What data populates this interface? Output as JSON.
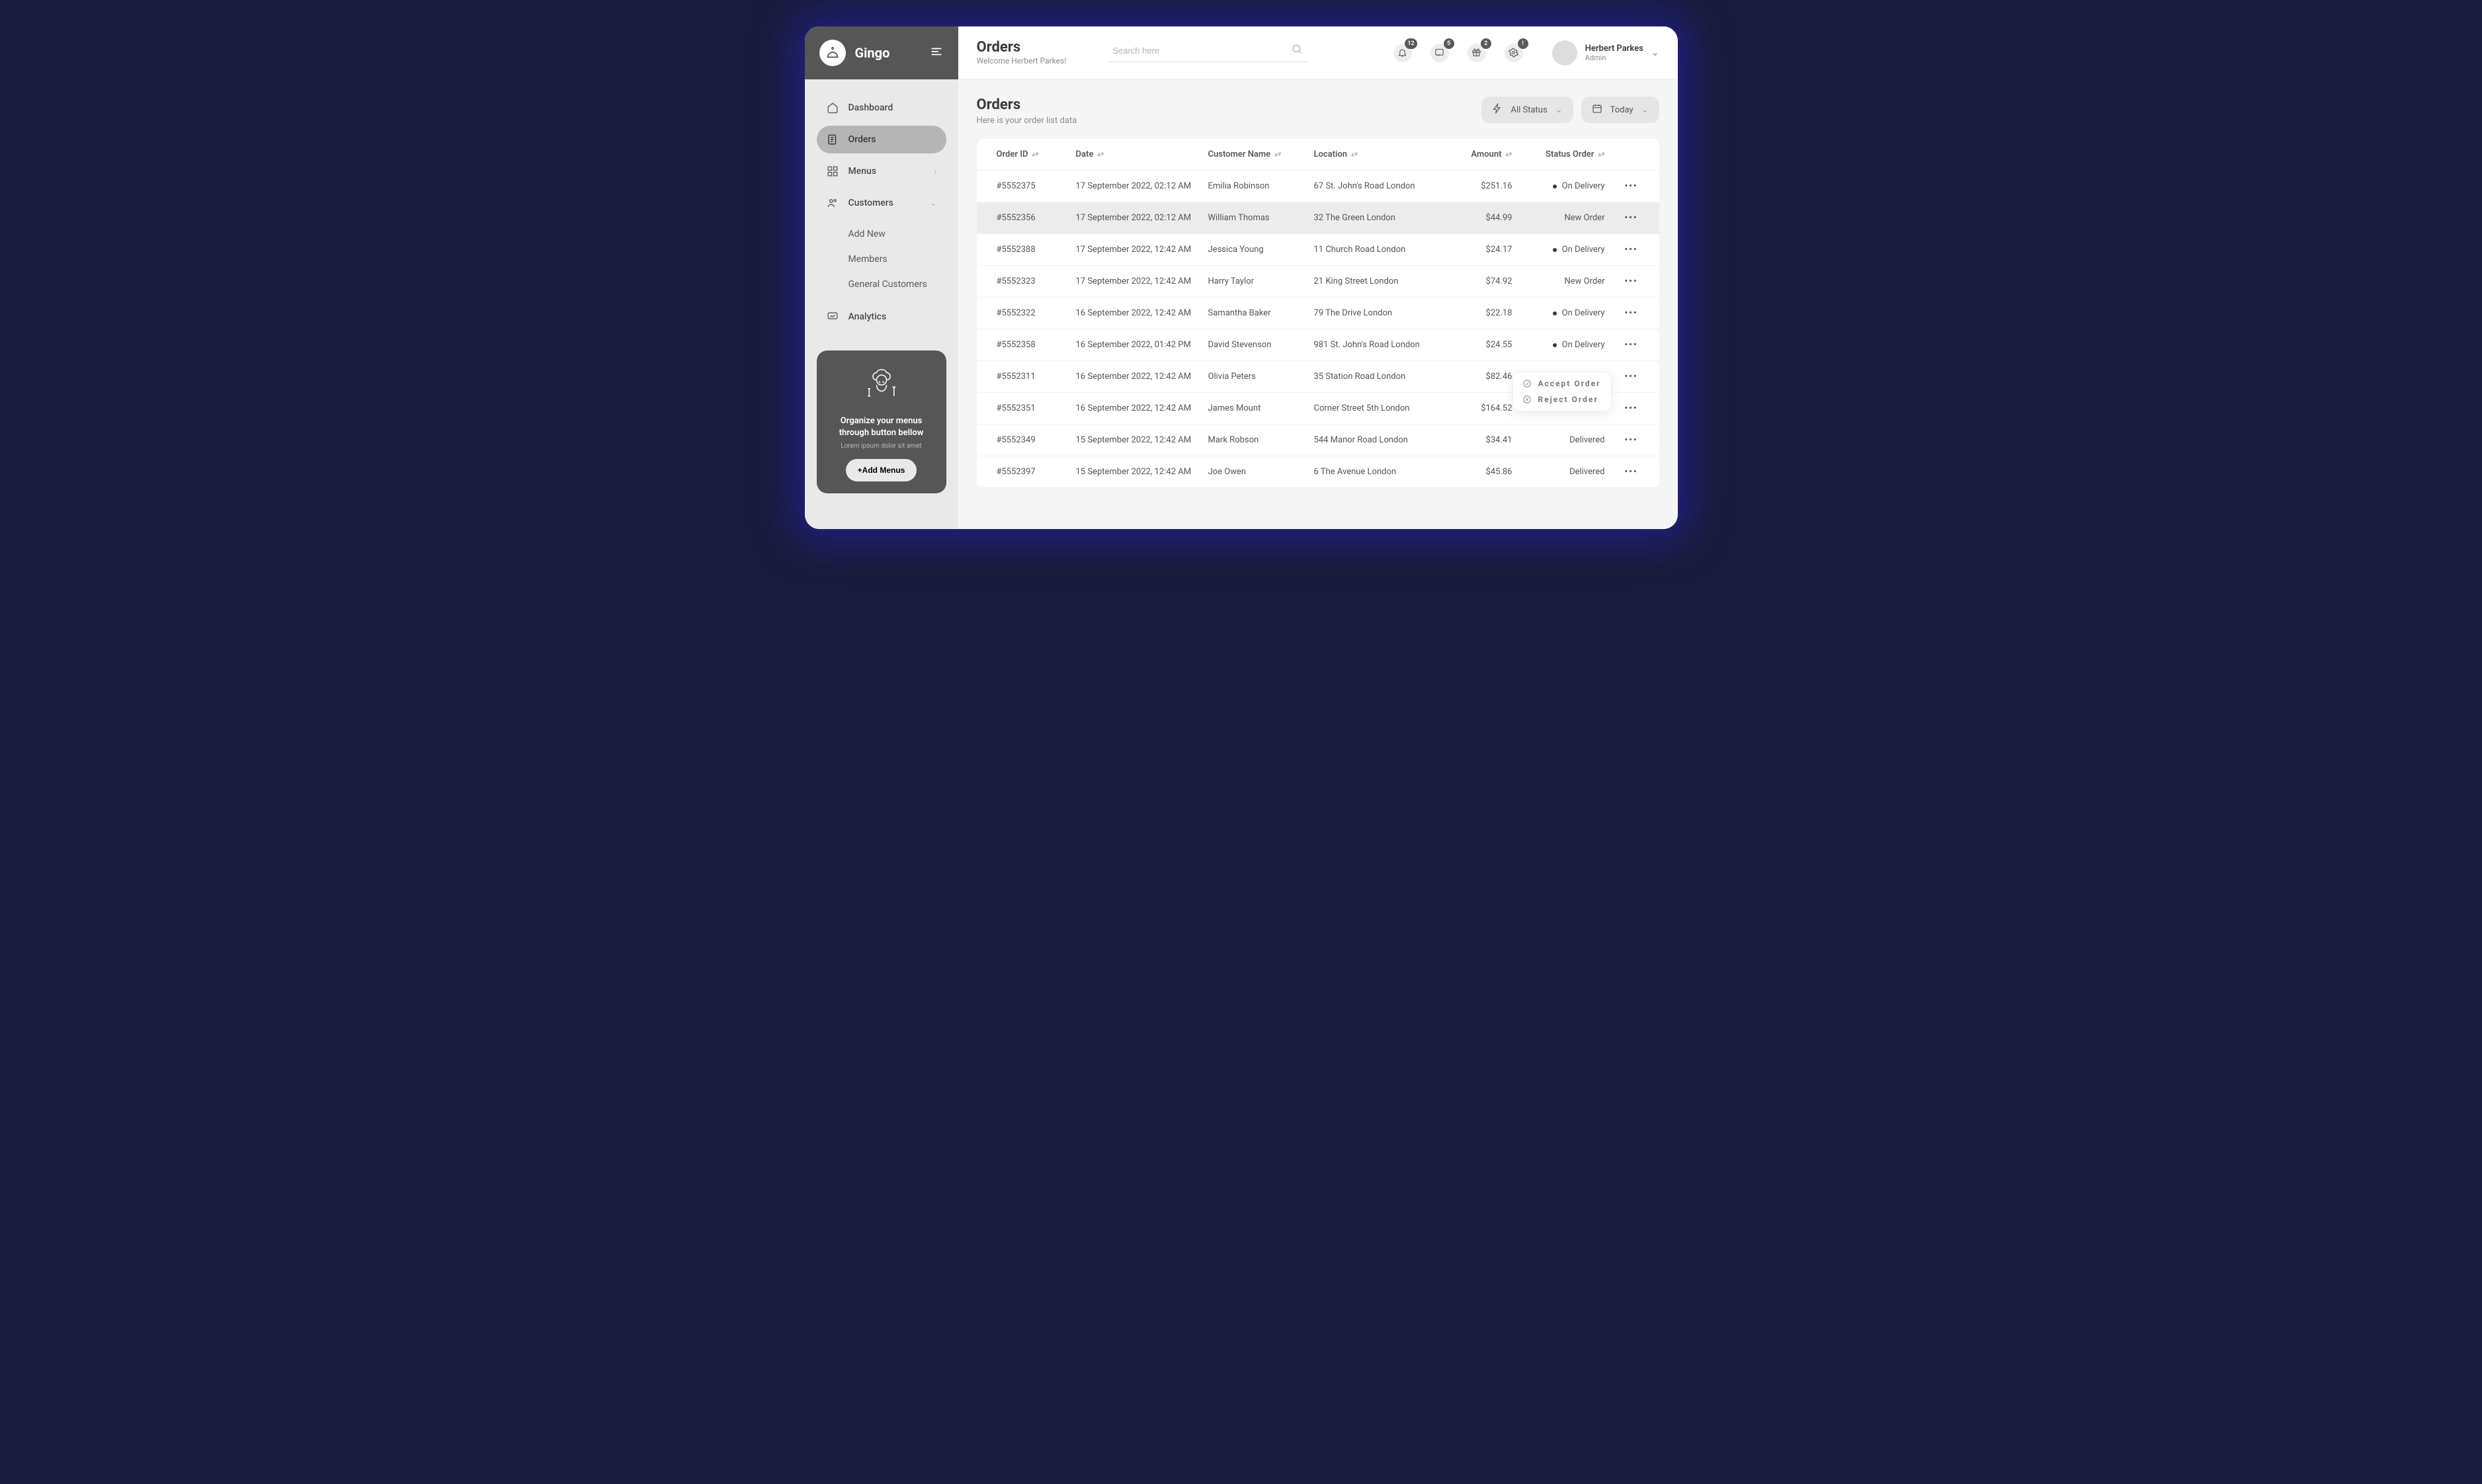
{
  "brand": {
    "name": "Gingo"
  },
  "nav": {
    "dashboard": "Dashboard",
    "orders": "Orders",
    "menus": "Menus",
    "customers": "Customers",
    "customers_sub": {
      "add": "Add New",
      "members": "Members",
      "general": "General Customers"
    },
    "analytics": "Analytics"
  },
  "promo": {
    "title": "Organize your menus through button bellow",
    "subtitle": "Lorem ipsum dolor sit amet",
    "button": "+Add Menus"
  },
  "topbar": {
    "title": "Orders",
    "welcome": "Welcome Herbert Parkes!",
    "search_placeholder": "Search here",
    "badges": {
      "bell": "12",
      "chat": "5",
      "gift": "2",
      "gear": "!"
    }
  },
  "user": {
    "name": "Herbert Parkes",
    "role": "Admin"
  },
  "page": {
    "title": "Orders",
    "subtitle": "Here is your order list data",
    "filter_status": "All Status",
    "filter_date": "Today"
  },
  "columns": {
    "order_id": "Order ID",
    "date": "Date",
    "customer": "Customer Name",
    "location": "Location",
    "amount": "Amount",
    "status": "Status Order"
  },
  "rows": [
    {
      "id": "#5552375",
      "date": "17 September 2022, 02:12 AM",
      "customer": "Emilia Robinson",
      "location": "67 St. John's Road London",
      "amount": "$251.16",
      "status": "On Delivery",
      "dot": true,
      "highlight": false,
      "popover": false
    },
    {
      "id": "#5552356",
      "date": "17 September 2022, 02:12 AM",
      "customer": "William Thomas",
      "location": "32 The Green London",
      "amount": "$44.99",
      "status": "New Order",
      "dot": false,
      "highlight": true,
      "popover": false
    },
    {
      "id": "#5552388",
      "date": "17 September 2022, 12:42 AM",
      "customer": "Jessica Young",
      "location": "11 Church Road London",
      "amount": "$24.17",
      "status": "On Delivery",
      "dot": true,
      "highlight": false,
      "popover": false
    },
    {
      "id": "#5552323",
      "date": "17 September 2022, 12:42 AM",
      "customer": "Harry Taylor",
      "location": "21 King Street London",
      "amount": "$74.92",
      "status": "New Order",
      "dot": false,
      "highlight": false,
      "popover": false
    },
    {
      "id": "#5552322",
      "date": "16 September 2022, 12:42 AM",
      "customer": "Samantha Baker",
      "location": "79 The Drive London",
      "amount": "$22.18",
      "status": "On Delivery",
      "dot": true,
      "highlight": false,
      "popover": false
    },
    {
      "id": "#5552358",
      "date": "16 September 2022, 01:42 PM",
      "customer": "David Stevenson",
      "location": "981 St. John's Road London",
      "amount": "$24.55",
      "status": "On Delivery",
      "dot": true,
      "highlight": false,
      "popover": false
    },
    {
      "id": "#5552311",
      "date": "16 September 2022, 12:42 AM",
      "customer": "Olivia Peters",
      "location": "35 Station Road London",
      "amount": "$82.46",
      "status": "",
      "dot": false,
      "highlight": false,
      "popover": true
    },
    {
      "id": "#5552351",
      "date": "16 September 2022, 12:42 AM",
      "customer": "James Mount",
      "location": "Corner Street 5th London",
      "amount": "$164.52",
      "status": "",
      "dot": false,
      "highlight": false,
      "popover": false
    },
    {
      "id": "#5552349",
      "date": "15 September 2022, 12:42 AM",
      "customer": "Mark Robson",
      "location": "544 Manor Road London",
      "amount": "$34.41",
      "status": "Delivered",
      "dot": false,
      "highlight": false,
      "popover": false
    },
    {
      "id": "#5552397",
      "date": "15 September 2022, 12:42 AM",
      "customer": "Joe Owen",
      "location": "6 The Avenue London",
      "amount": "$45.86",
      "status": "Delivered",
      "dot": false,
      "highlight": false,
      "popover": false
    }
  ],
  "popover": {
    "accept": "Accept Order",
    "reject": "Reject Order"
  }
}
